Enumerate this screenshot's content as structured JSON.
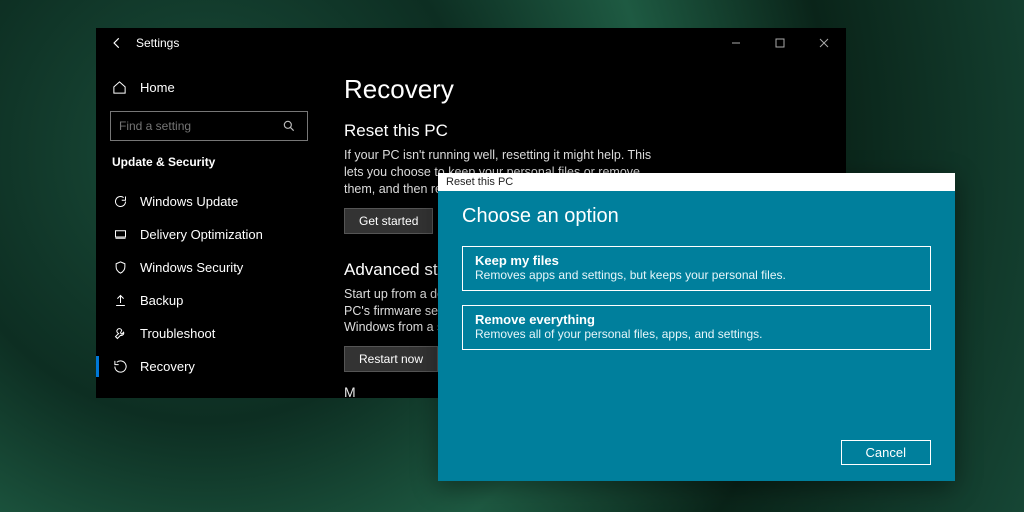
{
  "settings": {
    "window_title": "Settings",
    "home_label": "Home",
    "search_placeholder": "Find a setting",
    "section_label": "Update & Security",
    "nav": [
      {
        "label": "Windows Update"
      },
      {
        "label": "Delivery Optimization"
      },
      {
        "label": "Windows Security"
      },
      {
        "label": "Backup"
      },
      {
        "label": "Troubleshoot"
      },
      {
        "label": "Recovery"
      }
    ]
  },
  "main": {
    "title": "Recovery",
    "reset_heading": "Reset this PC",
    "reset_desc": "If your PC isn't running well, resetting it might help. This lets you choose to keep your personal files or remove them, and then reinstalls Windows.",
    "get_started": "Get started",
    "advanced_heading": "Advanced star",
    "advanced_desc": "Start up from a devi\nPC's firmware settin\nWindows from a sys",
    "restart_now": "Restart now",
    "more_cutoff": "M"
  },
  "dialog": {
    "title": "Reset this PC",
    "heading": "Choose an option",
    "options": [
      {
        "title": "Keep my files",
        "desc": "Removes apps and settings, but keeps your personal files."
      },
      {
        "title": "Remove everything",
        "desc": "Removes all of your personal files, apps, and settings."
      }
    ],
    "cancel": "Cancel"
  }
}
